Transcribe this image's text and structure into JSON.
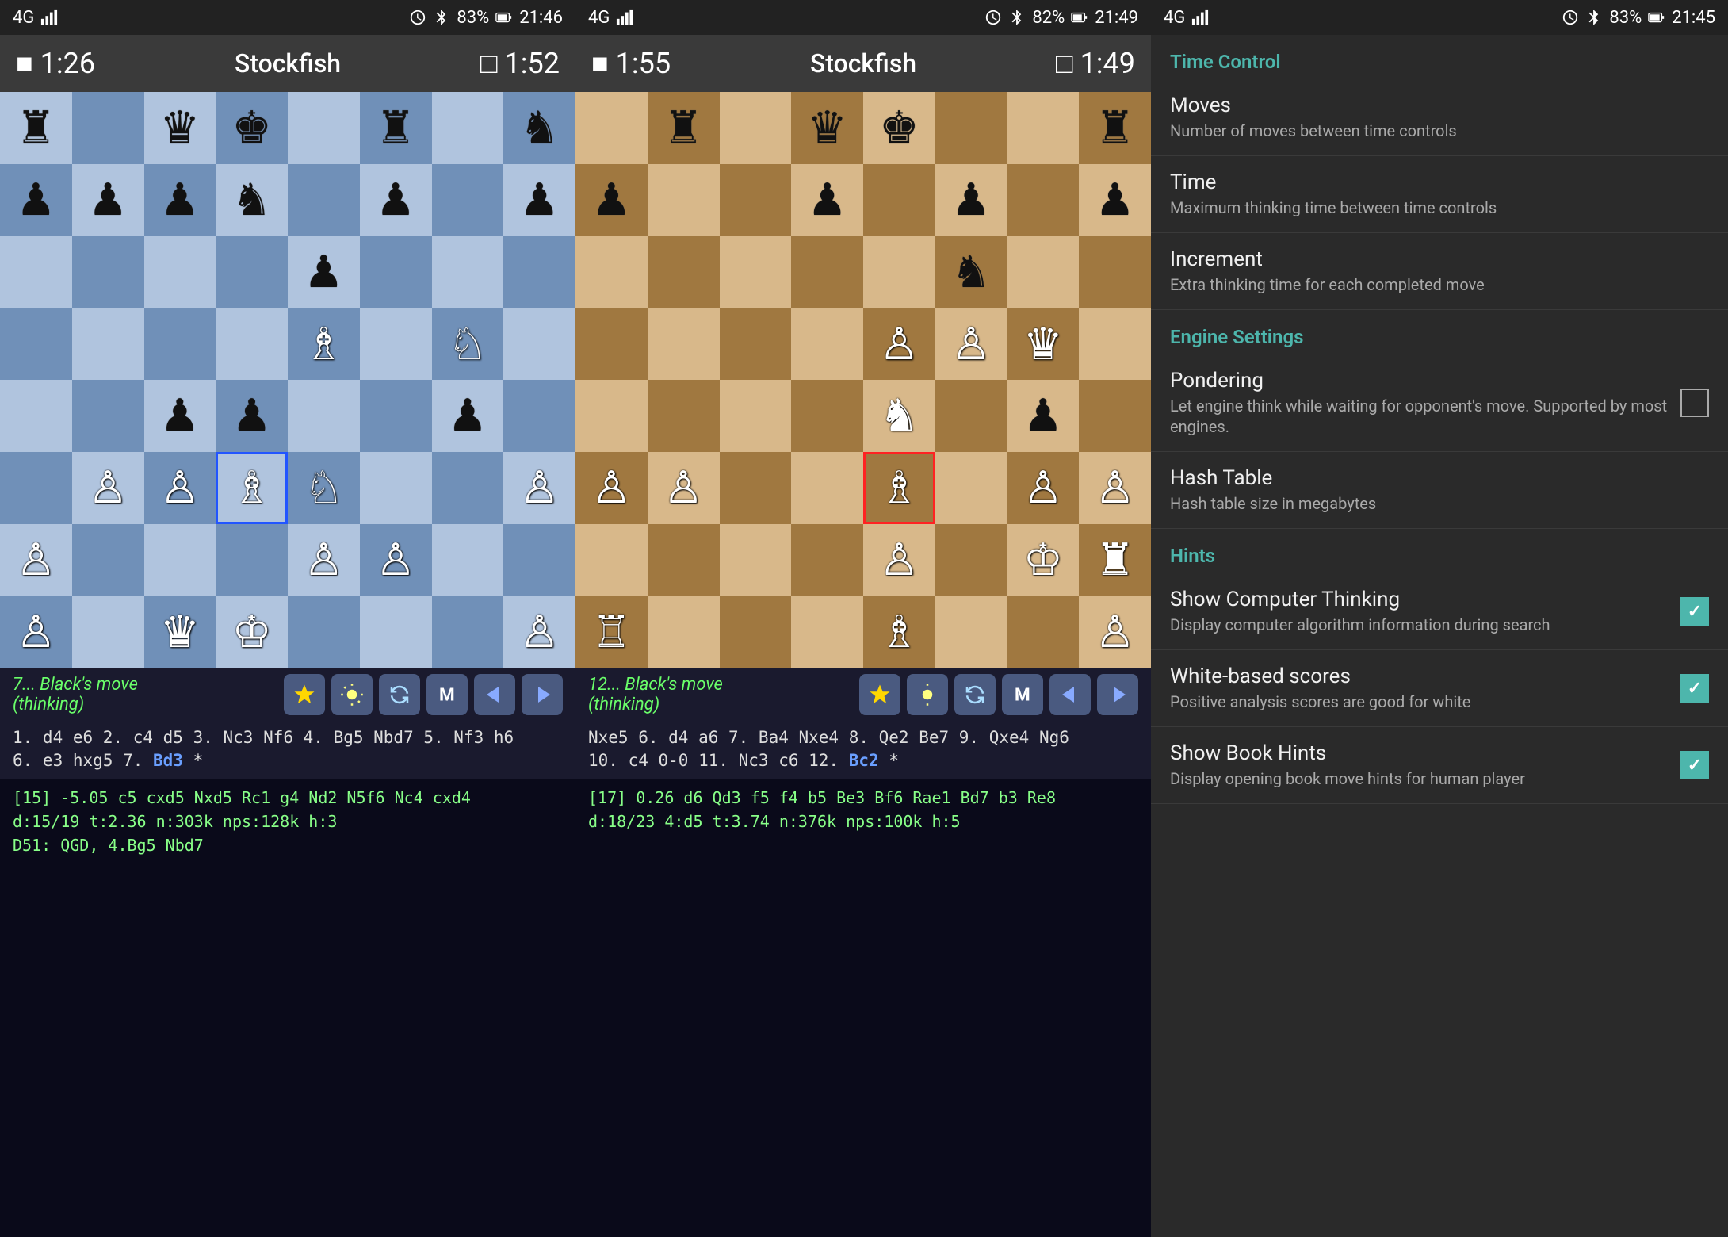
{
  "panel1": {
    "status": {
      "signal": "4G",
      "battery": "83%",
      "time": "21:46",
      "icons": [
        "alarm",
        "bluetooth"
      ]
    },
    "header": {
      "timer_left": "1:26",
      "title": "Stockfish",
      "timer_right": "1:52"
    },
    "board": {
      "cell_size": 90,
      "highlight_cell": "f4",
      "pieces": [
        {
          "row": 0,
          "col": 0,
          "piece": "♜",
          "color": "black"
        },
        {
          "row": 0,
          "col": 2,
          "piece": "♛",
          "color": "black"
        },
        {
          "row": 0,
          "col": 3,
          "piece": "♚",
          "color": "black"
        },
        {
          "row": 0,
          "col": 5,
          "piece": "♜",
          "color": "black"
        },
        {
          "row": 0,
          "col": 7,
          "piece": "♞",
          "color": "black"
        },
        {
          "row": 1,
          "col": 0,
          "piece": "♟",
          "color": "black"
        },
        {
          "row": 1,
          "col": 1,
          "piece": "♟",
          "color": "black"
        },
        {
          "row": 1,
          "col": 2,
          "piece": "♟",
          "color": "black"
        },
        {
          "row": 1,
          "col": 3,
          "piece": "♞",
          "color": "black"
        },
        {
          "row": 1,
          "col": 5,
          "piece": "♟",
          "color": "black"
        },
        {
          "row": 1,
          "col": 7,
          "piece": "♟",
          "color": "black"
        },
        {
          "row": 2,
          "col": 4,
          "piece": "♟",
          "color": "black"
        },
        {
          "row": 3,
          "col": 4,
          "piece": "♗",
          "color": "white"
        },
        {
          "row": 3,
          "col": 6,
          "piece": "♘",
          "color": "white"
        },
        {
          "row": 4,
          "col": 2,
          "piece": "♟",
          "color": "black"
        },
        {
          "row": 4,
          "col": 3,
          "piece": "♟",
          "color": "black"
        },
        {
          "row": 4,
          "col": 6,
          "piece": "♟",
          "color": "black"
        },
        {
          "row": 5,
          "col": 1,
          "piece": "♙",
          "color": "white"
        },
        {
          "row": 5,
          "col": 2,
          "piece": "♙",
          "color": "white"
        },
        {
          "row": 5,
          "col": 3,
          "piece": "♗",
          "color": "white",
          "highlight": "blue"
        },
        {
          "row": 5,
          "col": 4,
          "piece": "♘",
          "color": "white"
        },
        {
          "row": 5,
          "col": 7,
          "piece": "♙",
          "color": "white"
        },
        {
          "row": 6,
          "col": 0,
          "piece": "♙",
          "color": "white"
        },
        {
          "row": 6,
          "col": 4,
          "piece": "♙",
          "color": "white"
        },
        {
          "row": 6,
          "col": 5,
          "piece": "♙",
          "color": "white"
        },
        {
          "row": 7,
          "col": 0,
          "piece": "♙",
          "color": "white"
        },
        {
          "row": 7,
          "col": 2,
          "piece": "♛",
          "color": "white"
        },
        {
          "row": 7,
          "col": 3,
          "piece": "♔",
          "color": "white"
        },
        {
          "row": 7,
          "col": 7,
          "piece": "♙",
          "color": "white"
        }
      ]
    },
    "status_text": "7... Black's move\n(thinking)",
    "move_history": "1. d4 e6 2. c4 d5 3. Nc3 Nf6 4. Bg5 Nbd7 5. Nf3 h6\n6. e3 hxg5 7. Bd3 *",
    "move_highlight": "Bd3",
    "engine_lines": "[15] -5.05 c5 cxd5 Nxd5 Rc1 g4 Nd2 N5f6 Nc4 cxd4\nd:15/19 t:2.36 n:303k nps:128k h:3\nD51: QGD, 4.Bg5 Nbd7"
  },
  "panel2": {
    "status": {
      "signal": "4G",
      "battery": "82%",
      "time": "21:49",
      "icons": [
        "alarm",
        "bluetooth"
      ]
    },
    "header": {
      "timer_left": "1:55",
      "title": "Stockfish",
      "timer_right": "1:49"
    },
    "board": {
      "pieces": [
        {
          "row": 0,
          "col": 1,
          "piece": "♜",
          "color": "black"
        },
        {
          "row": 0,
          "col": 3,
          "piece": "♛",
          "color": "black"
        },
        {
          "row": 0,
          "col": 4,
          "piece": "♚",
          "color": "black"
        },
        {
          "row": 0,
          "col": 7,
          "piece": "♜",
          "color": "black"
        },
        {
          "row": 1,
          "col": 0,
          "piece": "♟",
          "color": "black"
        },
        {
          "row": 1,
          "col": 3,
          "piece": "♟",
          "color": "black"
        },
        {
          "row": 1,
          "col": 5,
          "piece": "♟",
          "color": "black"
        },
        {
          "row": 1,
          "col": 7,
          "piece": "♟",
          "color": "black"
        },
        {
          "row": 2,
          "col": 5,
          "piece": "♞",
          "color": "black"
        },
        {
          "row": 3,
          "col": 4,
          "piece": "♙",
          "color": "white"
        },
        {
          "row": 3,
          "col": 5,
          "piece": "♙",
          "color": "white"
        },
        {
          "row": 3,
          "col": 6,
          "piece": "♛",
          "color": "white"
        },
        {
          "row": 4,
          "col": 4,
          "piece": "♞",
          "color": "white"
        },
        {
          "row": 4,
          "col": 6,
          "piece": "♟",
          "color": "black"
        },
        {
          "row": 5,
          "col": 0,
          "piece": "♙",
          "color": "white"
        },
        {
          "row": 5,
          "col": 1,
          "piece": "♙",
          "color": "white"
        },
        {
          "row": 5,
          "col": 4,
          "piece": "♗",
          "color": "white",
          "highlight": "red"
        },
        {
          "row": 5,
          "col": 6,
          "piece": "♙",
          "color": "white"
        },
        {
          "row": 5,
          "col": 7,
          "piece": "♙",
          "color": "white"
        },
        {
          "row": 6,
          "col": 4,
          "piece": "♙",
          "color": "white"
        },
        {
          "row": 6,
          "col": 6,
          "piece": "♔",
          "color": "white"
        },
        {
          "row": 6,
          "col": 7,
          "piece": "♜",
          "color": "white"
        },
        {
          "row": 7,
          "col": 0,
          "piece": "♖",
          "color": "white"
        },
        {
          "row": 7,
          "col": 4,
          "piece": "♗",
          "color": "white"
        },
        {
          "row": 7,
          "col": 7,
          "piece": "♙",
          "color": "white"
        }
      ]
    },
    "status_text": "12... Black's move\n(thinking)",
    "move_history": "Nxe5 6. d4 a6 7. Ba4 Nxe4 8. Qe2 Be7 9. Qxe4 Ng6\n10. c4 0-0 11. Nc3 c6 12. Bc2 *",
    "move_highlight": "Bc2",
    "engine_lines": "[17] 0.26 d6 Qd3 f5 f4 b5 Be3 Bf6 Rae1 Bd7 b3 Re8\nd:18/23 4:d5 t:3.74 n:376k nps:100k h:5"
  },
  "settings": {
    "status": {
      "signal": "4G",
      "battery": "83%",
      "time": "21:45",
      "icons": [
        "alarm",
        "bluetooth"
      ]
    },
    "section_time_control": "Time Control",
    "items": [
      {
        "id": "moves",
        "title": "Moves",
        "desc": "Number of moves between time controls",
        "control": "none"
      },
      {
        "id": "time",
        "title": "Time",
        "desc": "Maximum thinking time between time controls",
        "control": "none"
      },
      {
        "id": "increment",
        "title": "Increment",
        "desc": "Extra thinking time for each completed move",
        "control": "none"
      }
    ],
    "section_engine": "Engine Settings",
    "engine_items": [
      {
        "id": "pondering",
        "title": "Pondering",
        "desc": "Let engine think while waiting for opponent's move. Supported by most engines.",
        "control": "checkbox",
        "checked": false
      },
      {
        "id": "hash_table",
        "title": "Hash Table",
        "desc": "Hash table size in megabytes",
        "control": "none"
      }
    ],
    "section_hints": "Hints",
    "hints_items": [
      {
        "id": "show_computer_thinking",
        "title": "Show Computer Thinking",
        "desc": "Display computer algorithm information during search",
        "control": "checkbox",
        "checked": true
      },
      {
        "id": "white_based_scores",
        "title": "White-based scores",
        "desc": "Positive analysis scores are good for white",
        "control": "checkbox",
        "checked": true
      },
      {
        "id": "show_book_hints",
        "title": "Show Book Hints",
        "desc": "Display opening book move hints for human player",
        "control": "checkbox",
        "checked": true
      }
    ]
  }
}
